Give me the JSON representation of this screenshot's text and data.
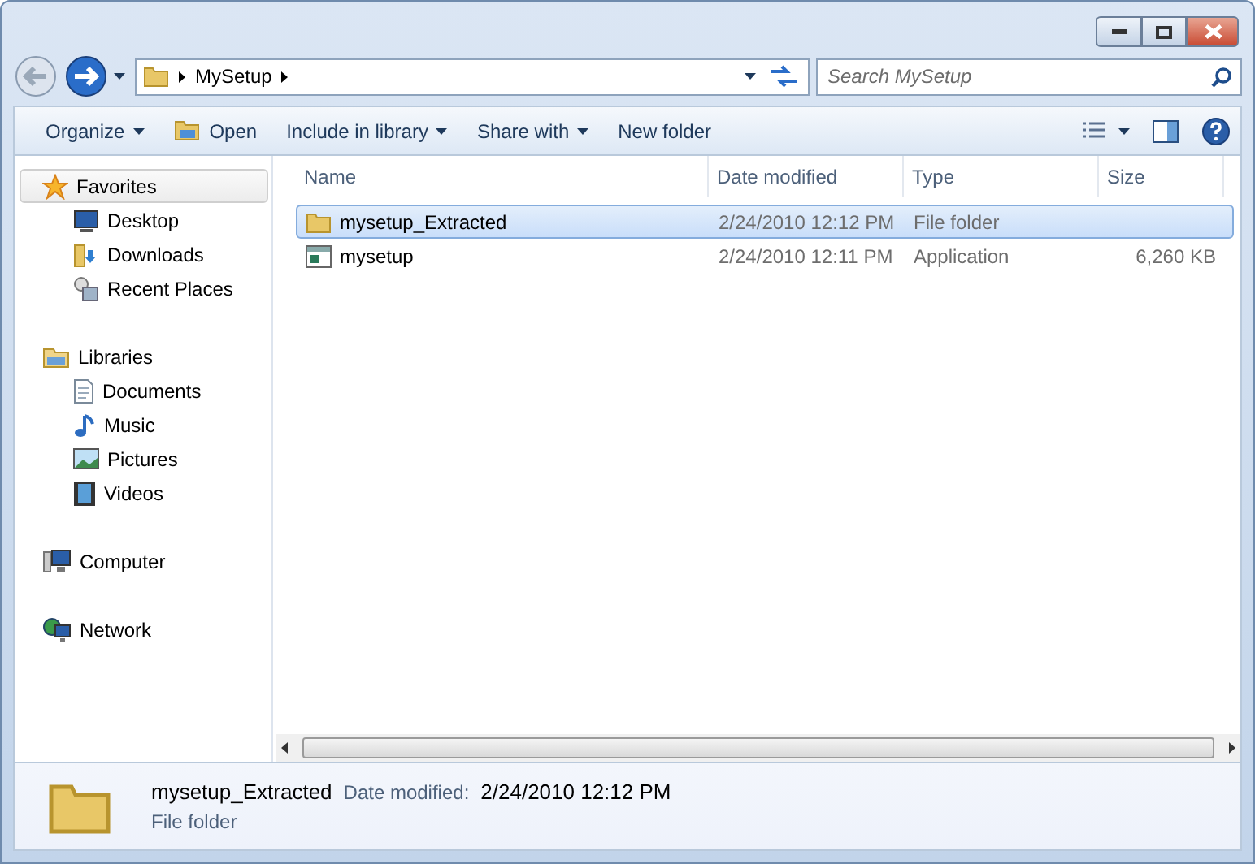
{
  "address": {
    "crumbs": [
      "MySetup"
    ]
  },
  "search": {
    "placeholder": "Search MySetup"
  },
  "toolbar": {
    "buttons": [
      {
        "label": "Organize",
        "dropdown": true,
        "kind": "plain"
      },
      {
        "label": "Open",
        "dropdown": false,
        "kind": "open"
      },
      {
        "label": "Include in library",
        "dropdown": true,
        "kind": "plain"
      },
      {
        "label": "Share with",
        "dropdown": true,
        "kind": "plain"
      },
      {
        "label": "New folder",
        "dropdown": false,
        "kind": "plain"
      }
    ]
  },
  "sidebar": {
    "groups": [
      {
        "label": "Favorites",
        "selected": true,
        "kind": "favorites",
        "children": [
          {
            "label": "Desktop",
            "selected": false,
            "kind": "desktop"
          },
          {
            "label": "Downloads",
            "selected": false,
            "kind": "downloads"
          },
          {
            "label": "Recent Places",
            "selected": false,
            "kind": "recent"
          }
        ]
      },
      {
        "label": "Libraries",
        "selected": false,
        "kind": "libraries",
        "children": [
          {
            "label": "Documents",
            "selected": false,
            "kind": "documents"
          },
          {
            "label": "Music",
            "selected": false,
            "kind": "music"
          },
          {
            "label": "Pictures",
            "selected": false,
            "kind": "pictures"
          },
          {
            "label": "Videos",
            "selected": false,
            "kind": "videos"
          }
        ]
      },
      {
        "label": "Computer",
        "selected": false,
        "kind": "computer"
      },
      {
        "label": "Network",
        "selected": false,
        "kind": "network"
      }
    ]
  },
  "table": {
    "columns": [
      "Name",
      "Date modified",
      "Type",
      "Size"
    ],
    "rows": [
      {
        "kind": "folder",
        "selected": true,
        "name": "mysetup_Extracted",
        "date": "2/24/2010 12:12 PM",
        "type": "File folder"
      },
      {
        "kind": "application",
        "selected": false,
        "name": "mysetup",
        "date": "2/24/2010 12:11 PM",
        "type": "Application",
        "size": "6,260 KB"
      }
    ]
  },
  "details": {
    "name": "mysetup_Extracted",
    "type": "File folder",
    "date_label": "Date modified:",
    "date": "2/24/2010 12:12 PM"
  }
}
